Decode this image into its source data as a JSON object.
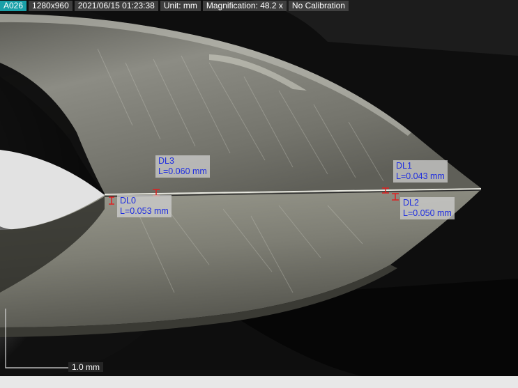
{
  "status_bar": {
    "image_id": "A026",
    "resolution": "1280x960",
    "datetime": "2021/06/15 01:23:38",
    "unit": "Unit: mm",
    "magnification": "Magnification:  48.2 x",
    "calibration": "No Calibration"
  },
  "measurements": [
    {
      "name": "DL0",
      "length": "L=0.053 mm"
    },
    {
      "name": "DL1",
      "length": "L=0.043 mm"
    },
    {
      "name": "DL2",
      "length": "L=0.050 mm"
    },
    {
      "name": "DL3",
      "length": "L=0.060 mm"
    }
  ],
  "scale_bar": {
    "label": "1.0 mm"
  },
  "colors": {
    "measure_text": "#1d2ce0",
    "measure_marker": "#e02020",
    "id_badge": "#1aa0a8"
  }
}
